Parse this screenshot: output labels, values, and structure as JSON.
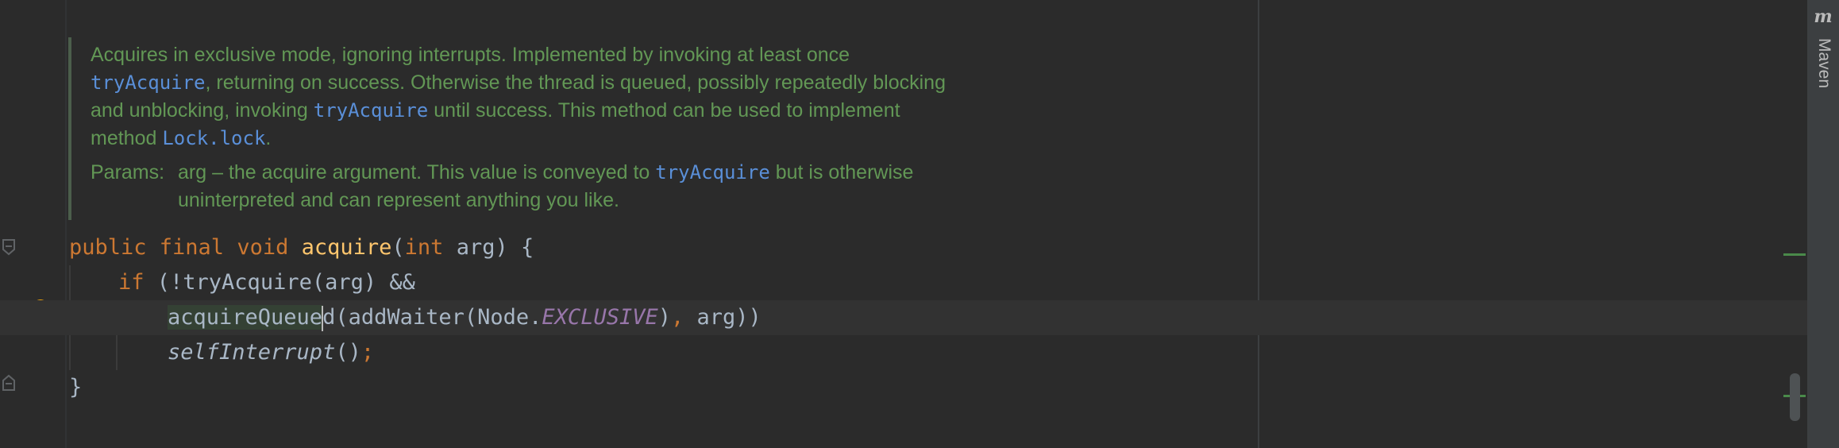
{
  "doc": {
    "line1": "Acquires in exclusive mode, ignoring interrupts. Implemented by invoking at least once",
    "line2_code": "tryAcquire",
    "line2_text": ", returning on success. Otherwise the thread is queued, possibly repeatedly blocking",
    "line3_text": "and unblocking, invoking ",
    "line3_code": "tryAcquire",
    "line3_rest": " until success. This method can be used to implement",
    "line4_text": "method ",
    "line4_code": "Lock.lock",
    "line4_rest": ".",
    "params_label": "Params:",
    "param_text": "arg – the acquire argument. This value is conveyed to ",
    "param_code": "tryAcquire",
    "param_rest": " but is otherwise",
    "param_line2": "uninterpreted and can represent anything you like."
  },
  "code": {
    "l1": {
      "kw": "public final void ",
      "fn": "acquire",
      "p1": "(",
      "kw2": "int",
      "p2": " arg) {"
    },
    "l2": {
      "kw": "if",
      "rest": " (!tryAcquire(arg) &&"
    },
    "l3": {
      "sel": "acquireQueue",
      "after": "d(addWaiter(Node.",
      "cst": "EXCLUSIVE",
      "p1": ")",
      "comma": ",",
      "p2": " arg))"
    },
    "l4": {
      "it": "selfInterrupt",
      "p": "()",
      "semi": ";"
    },
    "l5": "}"
  },
  "right_panel": {
    "logo": "m",
    "label": "Maven"
  }
}
